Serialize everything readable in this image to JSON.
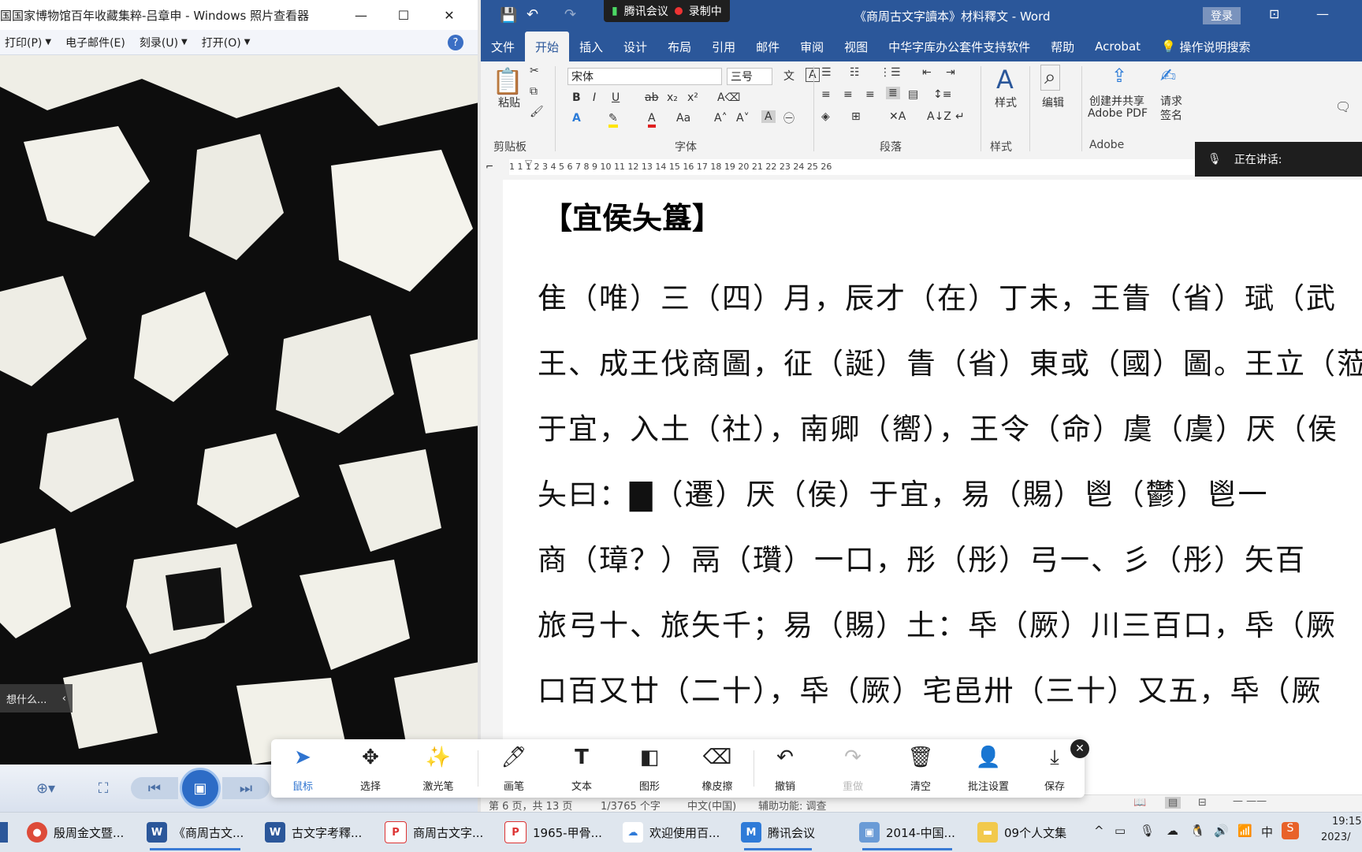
{
  "viewer": {
    "title": "国国家博物馆百年收藏集粹-吕章申 - Windows 照片查看器",
    "menu": [
      "打印(P)",
      "电子邮件(E)",
      "刻录(U)",
      "打开(O)"
    ],
    "help": "?",
    "tooltip": "想什么..."
  },
  "word": {
    "title": "《商周古文字讀本》材料釋文 - Word",
    "meeting": "腾讯会议",
    "recording": "录制中",
    "login": "登录",
    "tabs": [
      "文件",
      "开始",
      "插入",
      "设计",
      "布局",
      "引用",
      "邮件",
      "审阅",
      "视图",
      "中华字库办公套件支持软件",
      "帮助",
      "Acrobat",
      "操作说明搜索"
    ],
    "font_name": "宋体",
    "font_size": "三号",
    "groups": [
      "剪贴板",
      "字体",
      "段落",
      "样式",
      "Adobe"
    ],
    "paste_label": "粘贴",
    "styles_label": "样式",
    "edit_label": "编辑",
    "adobe_label_1": "创建并共享",
    "adobe_label_2": "Adobe PDF",
    "sign_label_1": "请求",
    "sign_label_2": "签名",
    "speaking": "正在讲话:",
    "ruler_numbers": "1  1  1  2  3  4  5  6  7  8  9  10  11  12  13  14  15  16  17  18  19  20  21  22  23  24  25  26",
    "doc_title": "【宜侯夨簋】",
    "doc_lines": [
      "隹（唯）三（四）月，辰才（在）丁未，王眚（省）珷（武",
      "王、成王伐商圖，征（誕）眚（省）東或（國）圖。王立（蒞",
      "于宜，入土（社），南卿（嚮），王令（命）虞（虞）厌（侯",
      "夨曰：▇（遷）厌（侯）于宜，易（賜）鬯（鬱）鬯一",
      "商（璋？）鬲（瓚）一口，彤（彤）弓一、彡（彤）矢百",
      "旅弓十、旅矢千；易（賜）土：氒（厥）川三百口，氒（厥",
      "口百又廿（二十），氒（厥）宅邑卅（三十）又五，氒（厥"
    ],
    "status": {
      "page": "第 6 页，共 13 页",
      "words": "1/3765 个字",
      "lang": "中文(中国)",
      "access": "辅助功能: 调查"
    }
  },
  "annotation_toolbar": {
    "tools": [
      "鼠标",
      "选择",
      "激光笔",
      "画笔",
      "文本",
      "图形",
      "橡皮擦",
      "撤销",
      "重做",
      "清空",
      "批注设置",
      "保存"
    ],
    "active": "鼠标"
  },
  "taskbar": {
    "items": [
      "殷周金文暨...",
      "《商周古文...",
      "古文字考釋...",
      "商周古文字...",
      "1965-甲骨...",
      "欢迎使用百...",
      "腾讯会议",
      "2014-中国...",
      "09个人文集"
    ],
    "ime": "中",
    "time": "19:15",
    "date": "2023/"
  }
}
